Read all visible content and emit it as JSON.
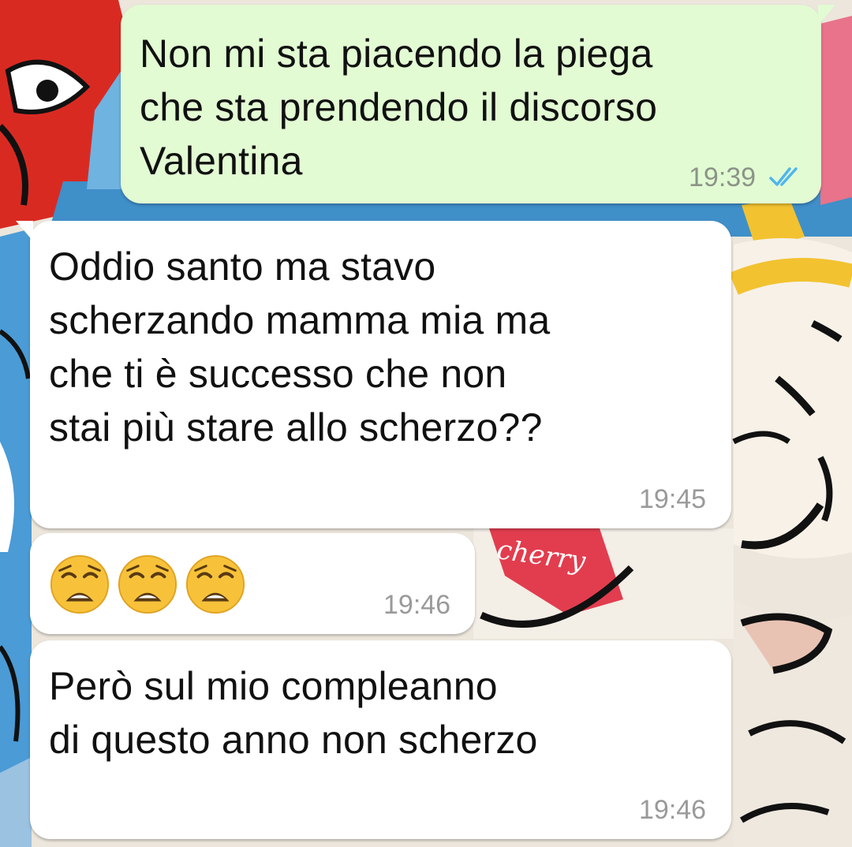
{
  "chat": {
    "wallpaper": "cartoon-sticker-collage",
    "colors": {
      "outgoing_bubble": "#e2fbd3",
      "incoming_bubble": "#ffffff",
      "read_ticks": "#4fb6ec",
      "timestamp": "#9a9a9a"
    },
    "messages": [
      {
        "direction": "outgoing",
        "text": "Non mi sta piacendo la piega\nche sta prendendo il discorso\nValentina",
        "time": "19:39",
        "status": "read"
      },
      {
        "direction": "incoming",
        "text": "Oddio santo ma stavo\nscherzando mamma mia ma\nche ti è successo che non\nstai più stare allo scherzo??",
        "time": "19:45"
      },
      {
        "direction": "incoming",
        "emoji": [
          "weary-face",
          "weary-face",
          "weary-face"
        ],
        "time": "19:46"
      },
      {
        "direction": "incoming",
        "text": "Però sul mio compleanno\ndi questo anno non scherzo",
        "time": "19:46"
      }
    ]
  }
}
